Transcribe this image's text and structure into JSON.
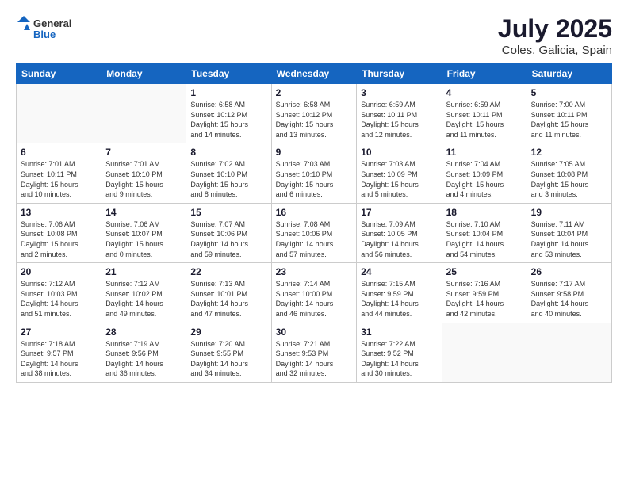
{
  "header": {
    "logo_general": "General",
    "logo_blue": "Blue",
    "month": "July 2025",
    "location": "Coles, Galicia, Spain"
  },
  "weekdays": [
    "Sunday",
    "Monday",
    "Tuesday",
    "Wednesday",
    "Thursday",
    "Friday",
    "Saturday"
  ],
  "weeks": [
    [
      {
        "day": "",
        "info": ""
      },
      {
        "day": "",
        "info": ""
      },
      {
        "day": "1",
        "info": "Sunrise: 6:58 AM\nSunset: 10:12 PM\nDaylight: 15 hours\nand 14 minutes."
      },
      {
        "day": "2",
        "info": "Sunrise: 6:58 AM\nSunset: 10:12 PM\nDaylight: 15 hours\nand 13 minutes."
      },
      {
        "day": "3",
        "info": "Sunrise: 6:59 AM\nSunset: 10:11 PM\nDaylight: 15 hours\nand 12 minutes."
      },
      {
        "day": "4",
        "info": "Sunrise: 6:59 AM\nSunset: 10:11 PM\nDaylight: 15 hours\nand 11 minutes."
      },
      {
        "day": "5",
        "info": "Sunrise: 7:00 AM\nSunset: 10:11 PM\nDaylight: 15 hours\nand 11 minutes."
      }
    ],
    [
      {
        "day": "6",
        "info": "Sunrise: 7:01 AM\nSunset: 10:11 PM\nDaylight: 15 hours\nand 10 minutes."
      },
      {
        "day": "7",
        "info": "Sunrise: 7:01 AM\nSunset: 10:10 PM\nDaylight: 15 hours\nand 9 minutes."
      },
      {
        "day": "8",
        "info": "Sunrise: 7:02 AM\nSunset: 10:10 PM\nDaylight: 15 hours\nand 8 minutes."
      },
      {
        "day": "9",
        "info": "Sunrise: 7:03 AM\nSunset: 10:10 PM\nDaylight: 15 hours\nand 6 minutes."
      },
      {
        "day": "10",
        "info": "Sunrise: 7:03 AM\nSunset: 10:09 PM\nDaylight: 15 hours\nand 5 minutes."
      },
      {
        "day": "11",
        "info": "Sunrise: 7:04 AM\nSunset: 10:09 PM\nDaylight: 15 hours\nand 4 minutes."
      },
      {
        "day": "12",
        "info": "Sunrise: 7:05 AM\nSunset: 10:08 PM\nDaylight: 15 hours\nand 3 minutes."
      }
    ],
    [
      {
        "day": "13",
        "info": "Sunrise: 7:06 AM\nSunset: 10:08 PM\nDaylight: 15 hours\nand 2 minutes."
      },
      {
        "day": "14",
        "info": "Sunrise: 7:06 AM\nSunset: 10:07 PM\nDaylight: 15 hours\nand 0 minutes."
      },
      {
        "day": "15",
        "info": "Sunrise: 7:07 AM\nSunset: 10:06 PM\nDaylight: 14 hours\nand 59 minutes."
      },
      {
        "day": "16",
        "info": "Sunrise: 7:08 AM\nSunset: 10:06 PM\nDaylight: 14 hours\nand 57 minutes."
      },
      {
        "day": "17",
        "info": "Sunrise: 7:09 AM\nSunset: 10:05 PM\nDaylight: 14 hours\nand 56 minutes."
      },
      {
        "day": "18",
        "info": "Sunrise: 7:10 AM\nSunset: 10:04 PM\nDaylight: 14 hours\nand 54 minutes."
      },
      {
        "day": "19",
        "info": "Sunrise: 7:11 AM\nSunset: 10:04 PM\nDaylight: 14 hours\nand 53 minutes."
      }
    ],
    [
      {
        "day": "20",
        "info": "Sunrise: 7:12 AM\nSunset: 10:03 PM\nDaylight: 14 hours\nand 51 minutes."
      },
      {
        "day": "21",
        "info": "Sunrise: 7:12 AM\nSunset: 10:02 PM\nDaylight: 14 hours\nand 49 minutes."
      },
      {
        "day": "22",
        "info": "Sunrise: 7:13 AM\nSunset: 10:01 PM\nDaylight: 14 hours\nand 47 minutes."
      },
      {
        "day": "23",
        "info": "Sunrise: 7:14 AM\nSunset: 10:00 PM\nDaylight: 14 hours\nand 46 minutes."
      },
      {
        "day": "24",
        "info": "Sunrise: 7:15 AM\nSunset: 9:59 PM\nDaylight: 14 hours\nand 44 minutes."
      },
      {
        "day": "25",
        "info": "Sunrise: 7:16 AM\nSunset: 9:59 PM\nDaylight: 14 hours\nand 42 minutes."
      },
      {
        "day": "26",
        "info": "Sunrise: 7:17 AM\nSunset: 9:58 PM\nDaylight: 14 hours\nand 40 minutes."
      }
    ],
    [
      {
        "day": "27",
        "info": "Sunrise: 7:18 AM\nSunset: 9:57 PM\nDaylight: 14 hours\nand 38 minutes."
      },
      {
        "day": "28",
        "info": "Sunrise: 7:19 AM\nSunset: 9:56 PM\nDaylight: 14 hours\nand 36 minutes."
      },
      {
        "day": "29",
        "info": "Sunrise: 7:20 AM\nSunset: 9:55 PM\nDaylight: 14 hours\nand 34 minutes."
      },
      {
        "day": "30",
        "info": "Sunrise: 7:21 AM\nSunset: 9:53 PM\nDaylight: 14 hours\nand 32 minutes."
      },
      {
        "day": "31",
        "info": "Sunrise: 7:22 AM\nSunset: 9:52 PM\nDaylight: 14 hours\nand 30 minutes."
      },
      {
        "day": "",
        "info": ""
      },
      {
        "day": "",
        "info": ""
      }
    ]
  ]
}
